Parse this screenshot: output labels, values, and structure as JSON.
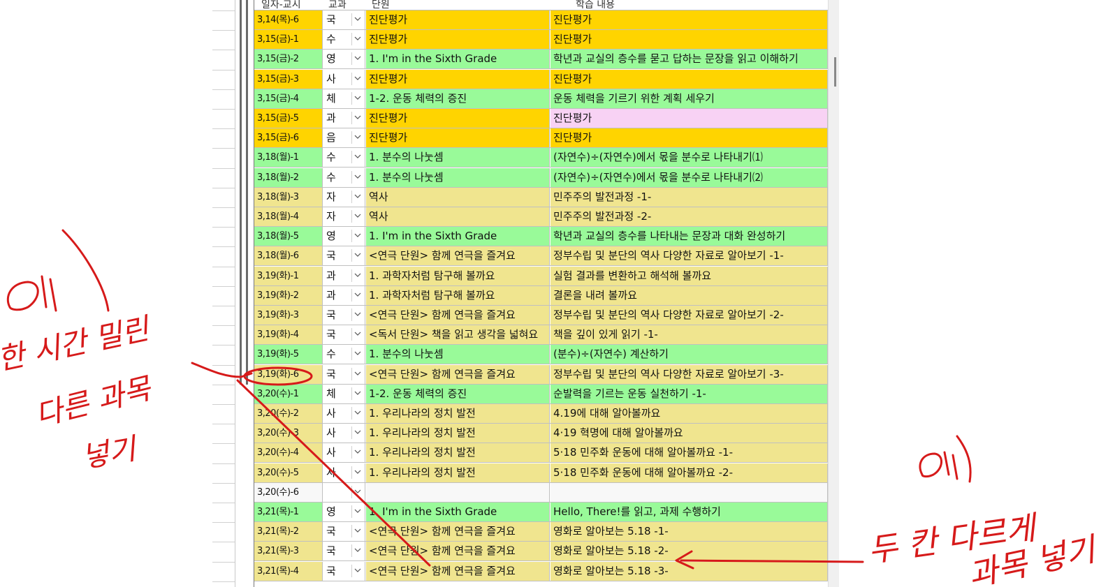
{
  "header": {
    "col_date": "일자-교시",
    "col_subject": "교과",
    "col_unit": "단원",
    "col_content": "학습 내용"
  },
  "rows": [
    {
      "date": "3,14(목)-6",
      "subject": "국",
      "unit": "진단평가",
      "content": "진단평가",
      "bg": "orange",
      "cbg": "orange"
    },
    {
      "date": "3,15(금)-1",
      "subject": "수",
      "unit": "진단평가",
      "content": "진단평가",
      "bg": "orange",
      "cbg": "orange"
    },
    {
      "date": "3,15(금)-2",
      "subject": "영",
      "unit": "1. I'm in the Sixth Grade",
      "content": "학년과 교실의 층수를 묻고 답하는 문장을 읽고 이해하기",
      "bg": "green",
      "cbg": "green"
    },
    {
      "date": "3,15(금)-3",
      "subject": "사",
      "unit": "진단평가",
      "content": "진단평가",
      "bg": "orange",
      "cbg": "orange"
    },
    {
      "date": "3,15(금)-4",
      "subject": "체",
      "unit": "1-2. 운동 체력의 증진",
      "content": "운동 체력을 기르기 위한 계획 세우기",
      "bg": "green",
      "cbg": "green"
    },
    {
      "date": "3,15(금)-5",
      "subject": "과",
      "unit": "진단평가",
      "content": "진단평가",
      "bg": "orange",
      "cbg": "pink"
    },
    {
      "date": "3,15(금)-6",
      "subject": "음",
      "unit": "진단평가",
      "content": "진단평가",
      "bg": "orange",
      "cbg": "orange"
    },
    {
      "date": "3,18(월)-1",
      "subject": "수",
      "unit": "1. 분수의 나눗셈",
      "content": "(자연수)÷(자연수)에서 몫을 분수로 나타내기⑴",
      "bg": "green",
      "cbg": "green"
    },
    {
      "date": "3,18(월)-2",
      "subject": "수",
      "unit": "1. 분수의 나눗셈",
      "content": "(자연수)÷(자연수)에서 몫을 분수로 나타내기⑵",
      "bg": "green",
      "cbg": "green"
    },
    {
      "date": "3,18(월)-3",
      "subject": "자",
      "unit": "역사",
      "content": "민주주의 발전과정 -1-",
      "bg": "khaki",
      "cbg": "khaki"
    },
    {
      "date": "3,18(월)-4",
      "subject": "자",
      "unit": "역사",
      "content": "민주주의 발전과정 -2-",
      "bg": "khaki",
      "cbg": "khaki"
    },
    {
      "date": "3,18(월)-5",
      "subject": "영",
      "unit": "1. I'm in the Sixth Grade",
      "content": "학년과 교실의 층수를 나타내는 문장과 대화 완성하기",
      "bg": "green",
      "cbg": "green"
    },
    {
      "date": "3,18(월)-6",
      "subject": "국",
      "unit": "<연극 단원> 함께 연극을 즐겨요",
      "content": "정부수립 및 분단의 역사 다양한 자료로 알아보기 -1-",
      "bg": "khaki",
      "cbg": "khaki"
    },
    {
      "date": "3,19(화)-1",
      "subject": "과",
      "unit": "1. 과학자처럼 탐구해 볼까요",
      "content": "실험 결과를 변환하고 해석해 볼까요",
      "bg": "khaki",
      "cbg": "khaki"
    },
    {
      "date": "3,19(화)-2",
      "subject": "과",
      "unit": "1. 과학자처럼 탐구해 볼까요",
      "content": "결론을 내려 볼까요",
      "bg": "khaki",
      "cbg": "khaki"
    },
    {
      "date": "3,19(화)-3",
      "subject": "국",
      "unit": "<연극 단원> 함께 연극을 즐겨요",
      "content": "정부수립 및 분단의 역사 다양한 자료로 알아보기 -2-",
      "bg": "khaki",
      "cbg": "khaki"
    },
    {
      "date": "3,19(화)-4",
      "subject": "국",
      "unit": "<독서 단원> 책을 읽고 생각을 넓혀요",
      "content": "책을 깊이 있게 읽기 -1-",
      "bg": "khaki",
      "cbg": "khaki"
    },
    {
      "date": "3,19(화)-5",
      "subject": "수",
      "unit": "1. 분수의 나눗셈",
      "content": "(분수)÷(자연수) 계산하기",
      "bg": "green",
      "cbg": "green"
    },
    {
      "date": "3,19(화)-6",
      "subject": "국",
      "unit": "<연극 단원> 함께 연극을 즐겨요",
      "content": "정부수립 및 분단의 역사 다양한 자료로 알아보기 -3-",
      "bg": "khaki",
      "cbg": "khaki"
    },
    {
      "date": "3,20(수)-1",
      "subject": "체",
      "unit": "1-2. 운동 체력의 증진",
      "content": "순발력을 기르는 운동 실천하기 -1-",
      "bg": "green",
      "cbg": "green"
    },
    {
      "date": "3,20(수)-2",
      "subject": "사",
      "unit": "1. 우리나라의 정치 발전",
      "content": "4.19에 대해 알아볼까요",
      "bg": "khaki",
      "cbg": "khaki"
    },
    {
      "date": "3,20(수)-3",
      "subject": "사",
      "unit": "1. 우리나라의 정치 발전",
      "content": "4·19 혁명에 대해 알아볼까요",
      "bg": "khaki",
      "cbg": "khaki"
    },
    {
      "date": "3,20(수)-4",
      "subject": "사",
      "unit": "1. 우리나라의 정치 발전",
      "content": "5·18 민주화 운동에 대해 알아볼까요 -1-",
      "bg": "khaki",
      "cbg": "khaki"
    },
    {
      "date": "3,20(수)-5",
      "subject": "사",
      "unit": "1. 우리나라의 정치 발전",
      "content": "5·18 민주화 운동에 대해 알아볼까요 -2-",
      "bg": "khaki",
      "cbg": "khaki"
    },
    {
      "date": "3,20(수)-6",
      "subject": "",
      "unit": "",
      "content": "",
      "bg": "white",
      "cbg": "white"
    },
    {
      "date": "3,21(목)-1",
      "subject": "영",
      "unit": "1. I'm in the Sixth Grade",
      "content": "Hello, There!를 읽고, 과제 수행하기",
      "bg": "green",
      "cbg": "green"
    },
    {
      "date": "3,21(목)-2",
      "subject": "국",
      "unit": "<연극 단원> 함께 연극을 즐겨요",
      "content": "영화로 알아보는 5.18 -1-",
      "bg": "khaki",
      "cbg": "khaki"
    },
    {
      "date": "3,21(목)-3",
      "subject": "국",
      "unit": "<연극 단원> 함께 연극을 즐겨요",
      "content": "영화로 알아보는 5.18 -2-",
      "bg": "khaki",
      "cbg": "khaki"
    },
    {
      "date": "3,21(목)-4",
      "subject": "국",
      "unit": "<연극 단원> 함께 연극을 즐겨요",
      "content": "영화로 알아보는 5.18 -3-",
      "bg": "khaki",
      "cbg": "khaki"
    }
  ],
  "annotations": {
    "left_note": [
      "예)",
      "한 시간 밀린",
      "다른 과목",
      "넣기"
    ],
    "right_note": [
      "예)",
      "두 칸 다르게",
      "과목 넣기"
    ],
    "ink_color": "#d61a1a"
  }
}
